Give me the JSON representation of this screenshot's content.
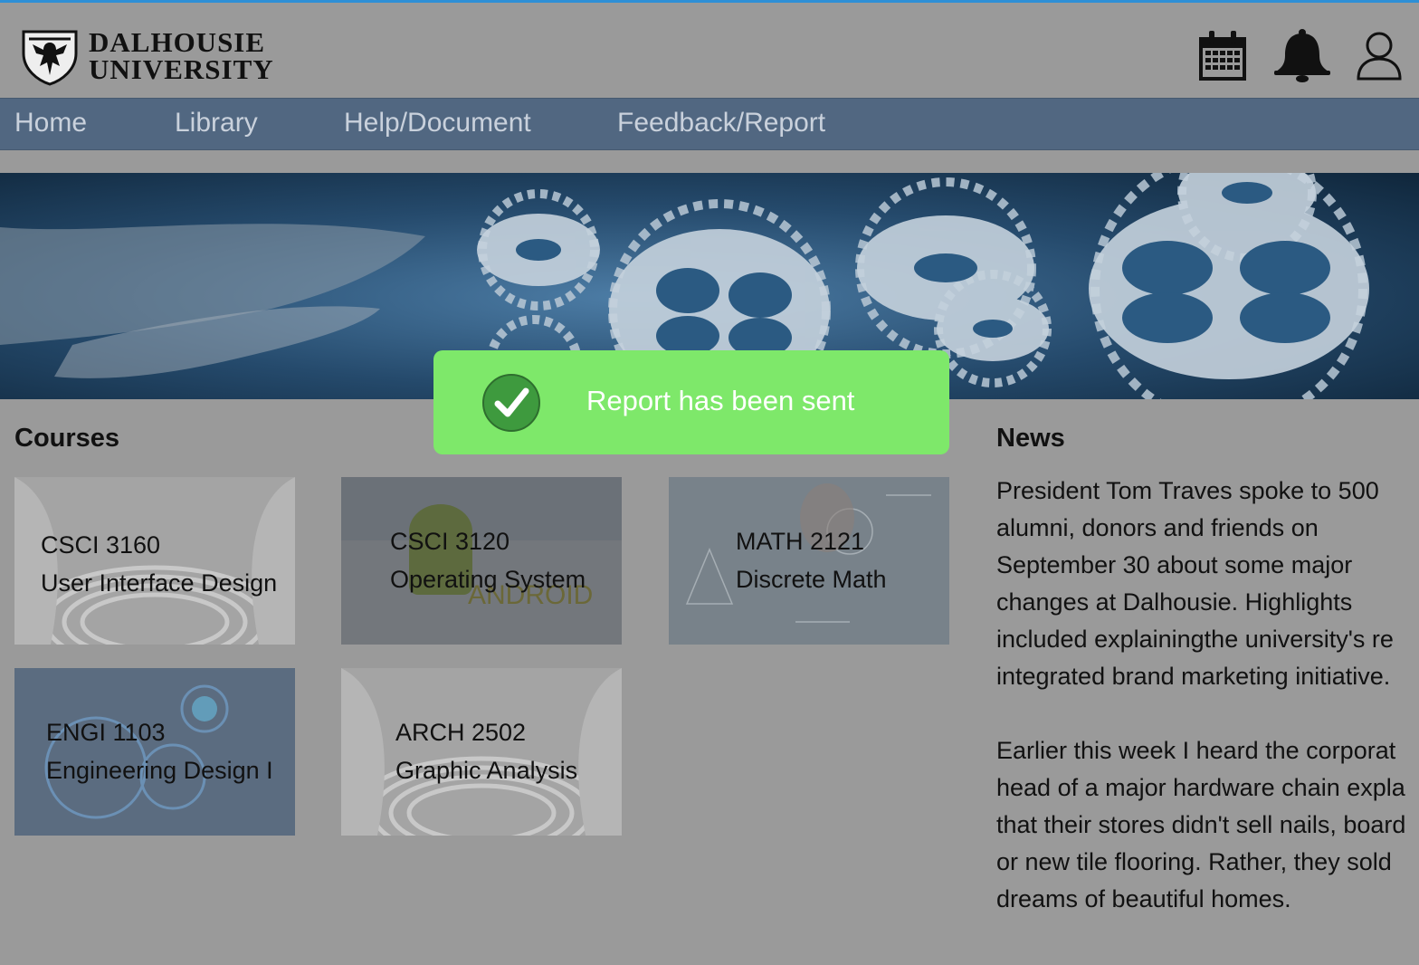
{
  "header": {
    "logo_line1": "DALHOUSIE",
    "logo_line2": "UNIVERSITY",
    "icons": [
      "calendar-icon",
      "bell-icon",
      "user-icon"
    ]
  },
  "nav": {
    "items": [
      "Home",
      "Library",
      "Help/Document",
      "Feedback/Report"
    ]
  },
  "courses": {
    "title": "Courses",
    "cards": [
      {
        "code": "CSCI 3160",
        "name": "User Interface Design"
      },
      {
        "code": "CSCI 3120",
        "name": "Operating System"
      },
      {
        "code": "MATH 2121",
        "name": "Discrete Math"
      },
      {
        "code": "ENGI 1103",
        "name": "Engineering Design I"
      },
      {
        "code": "ARCH 2502",
        "name": "Graphic Analysis"
      }
    ]
  },
  "news": {
    "title": "News",
    "paragraphs": [
      "President Tom Traves spoke to 500\nalumni, donors and friends on\nSeptember 30 about some major\nchanges at Dalhousie. Highlights\nincluded explainingthe university's re\nintegrated brand marketing initiative.",
      "Earlier this week I heard the corporat\nhead of a major hardware chain expla\nthat their stores didn't sell nails, board\nor new tile flooring. Rather, they sold\ndreams of beautiful homes."
    ]
  },
  "toast": {
    "message": "Report has been sent",
    "color": "#7ee86a"
  }
}
